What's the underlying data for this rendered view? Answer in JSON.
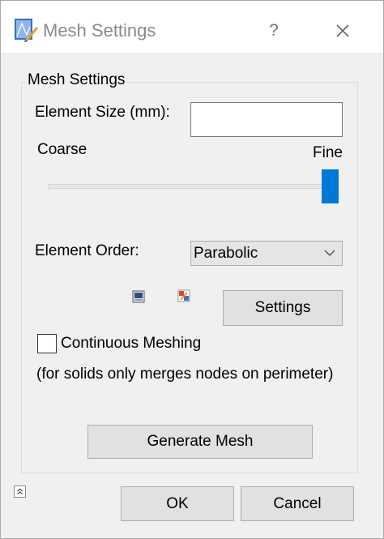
{
  "window": {
    "title": "Mesh Settings",
    "icon": "mesh-app-icon",
    "help_label": "?",
    "close_icon": "close-icon"
  },
  "group": {
    "title": "Mesh Settings"
  },
  "element_size": {
    "label": "Element Size (mm):",
    "value": ""
  },
  "slider": {
    "min_label": "Coarse",
    "max_label": "Fine",
    "level": 1.0
  },
  "element_order": {
    "label": "Element Order:",
    "selected": "Parabolic"
  },
  "toolbar_icons": [
    "display-icon",
    "color-wand-icon"
  ],
  "buttons": {
    "settings": "Settings",
    "generate": "Generate Mesh",
    "ok": "OK",
    "cancel": "Cancel"
  },
  "continuous_meshing": {
    "label": "Continuous Meshing",
    "checked": false,
    "note": "(for solids only merges nodes on perimeter)"
  },
  "colors": {
    "accent": "#0078d7",
    "button_face": "#e1e1e1",
    "title_text": "#8a8a8a"
  }
}
